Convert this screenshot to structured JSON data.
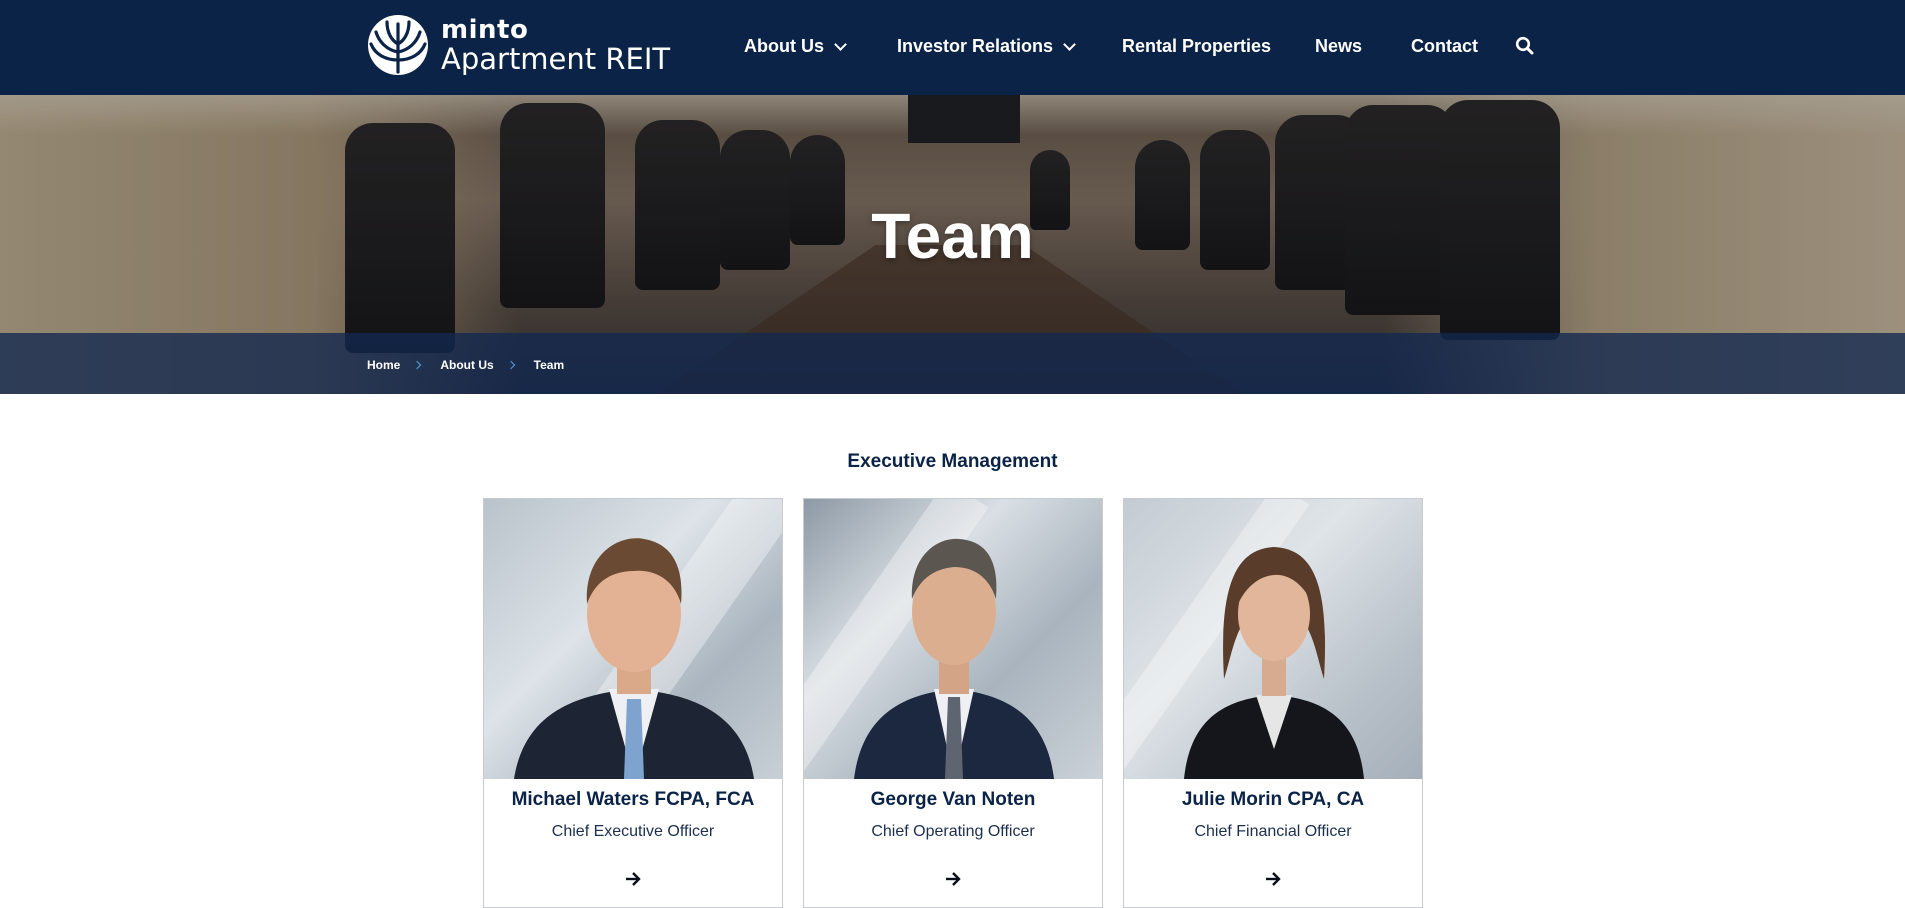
{
  "brand": {
    "name_top": "minto",
    "name_bottom": "Apartment REIT"
  },
  "nav": {
    "items": [
      {
        "label": "About Us",
        "has_dropdown": true
      },
      {
        "label": "Investor Relations",
        "has_dropdown": true
      },
      {
        "label": "Rental Properties",
        "has_dropdown": false
      },
      {
        "label": "News",
        "has_dropdown": false
      },
      {
        "label": "Contact",
        "has_dropdown": false
      }
    ],
    "search_icon": "search-icon"
  },
  "hero": {
    "title": "Team"
  },
  "breadcrumb": [
    {
      "label": "Home"
    },
    {
      "label": "About Us"
    },
    {
      "label": "Team"
    }
  ],
  "section": {
    "title": "Executive Management"
  },
  "team": [
    {
      "name": "Michael Waters FCPA, FCA",
      "role": "Chief Executive Officer",
      "icon": "arrow-right-icon"
    },
    {
      "name": "George Van Noten",
      "role": "Chief Operating Officer",
      "icon": "arrow-right-icon"
    },
    {
      "name": "Julie Morin CPA, CA",
      "role": "Chief Financial Officer",
      "icon": "arrow-right-icon"
    }
  ],
  "colors": {
    "header_bg": "#0a2346",
    "breadcrumb_bg": "#122850",
    "text_dark": "#0a2346",
    "accent": "#5aa0e0"
  }
}
